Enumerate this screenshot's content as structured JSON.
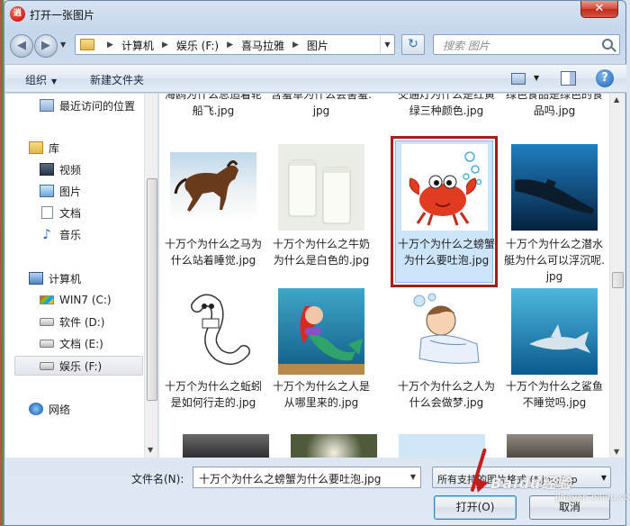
{
  "window": {
    "title": "打开一张图片",
    "app_icon": "逍",
    "close_symbol": "✕"
  },
  "navigation": {
    "back_symbol": "◀",
    "forward_symbol": "▶",
    "refresh_symbol": "↻"
  },
  "address": {
    "crumbs": [
      "计算机",
      "娱乐 (F:)",
      "喜马拉雅",
      "图片"
    ]
  },
  "search": {
    "placeholder": "搜索 图片"
  },
  "toolbar": {
    "organize_label": "组织",
    "new_folder_label": "新建文件夹"
  },
  "nav_pane": {
    "items": [
      {
        "label": "最近访问的位置",
        "icon": "recent-places-icon"
      },
      {
        "label": "库",
        "icon": "library-icon"
      },
      {
        "label": "视频",
        "icon": "video-icon"
      },
      {
        "label": "图片",
        "icon": "pictures-icon"
      },
      {
        "label": "文档",
        "icon": "documents-icon"
      },
      {
        "label": "音乐",
        "icon": "music-icon"
      },
      {
        "label": "计算机",
        "icon": "computer-icon"
      },
      {
        "label": "WIN7 (C:)",
        "icon": "windows-drive-icon"
      },
      {
        "label": "软件 (D:)",
        "icon": "drive-icon"
      },
      {
        "label": "文档 (E:)",
        "icon": "drive-icon"
      },
      {
        "label": "娱乐 (F:)",
        "icon": "drive-icon",
        "selected": true
      },
      {
        "label": "网络",
        "icon": "network-icon"
      }
    ]
  },
  "files": {
    "row0": [
      "海鸥为什么总追着轮船飞.jpg",
      "含羞草为什么会害羞.jpg",
      "交通灯为什么是红黄绿三种颜色.jpg",
      "绿色食品是绿色的食品吗.jpg"
    ],
    "row1": [
      "十万个为什么之马为什么站着睡觉.jpg",
      "十万个为什么之牛奶为什么是白色的.jpg",
      "十万个为什么之螃蟹为什么要吐泡.jpg",
      "十万个为什么之潜水艇为什么可以浮沉呢.jpg"
    ],
    "row2": [
      "十万个为什么之蚯蚓是如何行走的.jpg",
      "十万个为什么之人是从哪里来的.jpg",
      "十万个为什么之人为什么会做梦.jpg",
      "十万个为什么之鲨鱼不睡觉吗.jpg"
    ],
    "selected_index": "row1-2"
  },
  "footer": {
    "filename_label": "文件名(N):",
    "filename_value": "十万个为什么之螃蟹为什么要吐泡.jpg",
    "filter_value": "所有支持的图片格式 (*.jpg;*.jp",
    "open_label": "打开(O)",
    "cancel_label": "取消"
  },
  "watermark": {
    "text": "Baidu经验",
    "sub": "jingyan.baidu.com"
  },
  "colors": {
    "selection_border": "#a51d1d",
    "selection_fill": "#cde5fb",
    "arrow": "#c41d1d"
  }
}
